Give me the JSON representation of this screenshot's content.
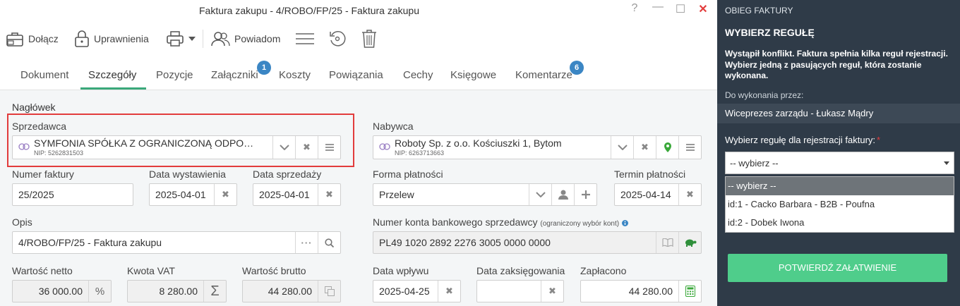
{
  "window": {
    "title": "Faktura zakupu - 4/ROBO/FP/25 - Faktura zakupu",
    "controls": {
      "help": "?",
      "minimize": "—",
      "maximize": "☐",
      "close": "✕"
    }
  },
  "toolbar": {
    "attach": "Dołącz",
    "permissions": "Uprawnienia",
    "notify": "Powiadom"
  },
  "tabs": [
    {
      "label": "Dokument"
    },
    {
      "label": "Szczegóły"
    },
    {
      "label": "Pozycje"
    },
    {
      "label": "Załączniki",
      "badge": "1"
    },
    {
      "label": "Koszty"
    },
    {
      "label": "Powiązania"
    },
    {
      "label": "Cechy"
    },
    {
      "label": "Księgowe"
    },
    {
      "label": "Komentarze",
      "badge": "6"
    }
  ],
  "form": {
    "section_title": "Nagłówek",
    "seller": {
      "label": "Sprzedawca",
      "name": "SYMFONIA SPÓŁKA Z OGRANICZONĄ ODPOWIEDZIALNOŚCIĄ",
      "nip": "NIP: 5262831503"
    },
    "buyer": {
      "label": "Nabywca",
      "name": "Roboty Sp. z o.o. Kościuszki 1, Bytom",
      "nip": "NIP: 6263713663"
    },
    "invoice_number": {
      "label": "Numer faktury",
      "value": "25/2025"
    },
    "issue_date": {
      "label": "Data wystawienia",
      "value": "2025-04-01"
    },
    "sale_date": {
      "label": "Data sprzedaży",
      "value": "2025-04-01"
    },
    "payment_form": {
      "label": "Forma płatności",
      "value": "Przelew"
    },
    "payment_due": {
      "label": "Termin płatności",
      "value": "2025-04-14"
    },
    "description": {
      "label": "Opis",
      "value": "4/ROBO/FP/25 - Faktura zakupu"
    },
    "bank_account": {
      "label": "Numer konta bankowego sprzedawcy",
      "note": "(ograniczony wybór kont)",
      "value": "PL49 1020 2892 2276 3005 0000 0000"
    },
    "net": {
      "label": "Wartość netto",
      "value": "36 000.00"
    },
    "vat": {
      "label": "Kwota VAT",
      "value": "8 280.00"
    },
    "gross": {
      "label": "Wartość brutto",
      "value": "44 280.00"
    },
    "receipt_date": {
      "label": "Data wpływu",
      "value": "2025-04-25"
    },
    "booking_date": {
      "label": "Data zaksięgowania",
      "value": ""
    },
    "paid": {
      "label": "Zapłacono",
      "value": "44 280.00"
    }
  },
  "panel": {
    "header": "OBIEG FAKTURY",
    "title": "WYBIERZ REGUŁĘ",
    "description": "Wystąpił konflikt. Faktura spełnia kilka reguł rejestracji. Wybierz jedną z pasujących reguł, która zostanie wykonana.",
    "executor_label": "Do wykonania przez:",
    "executor": "Wiceprezes zarządu - Łukasz Mądry",
    "rule_label": "Wybierz regułę dla rejestracji faktury:",
    "required_mark": "*",
    "select_value": "-- wybierz --",
    "options": [
      "-- wybierz --",
      "id:1 - Cacko Barbara - B2B - Poufna",
      "id:2 - Dobek Iwona"
    ],
    "confirm_button": "POTWIERDŹ ZAŁATWIENIE"
  },
  "colors": {
    "accent_green": "#3aa87a",
    "badge_blue": "#3b86c4",
    "panel_bg": "#2f3b48",
    "confirm_green": "#4fcd8b",
    "highlight_red": "#e23c3c"
  }
}
